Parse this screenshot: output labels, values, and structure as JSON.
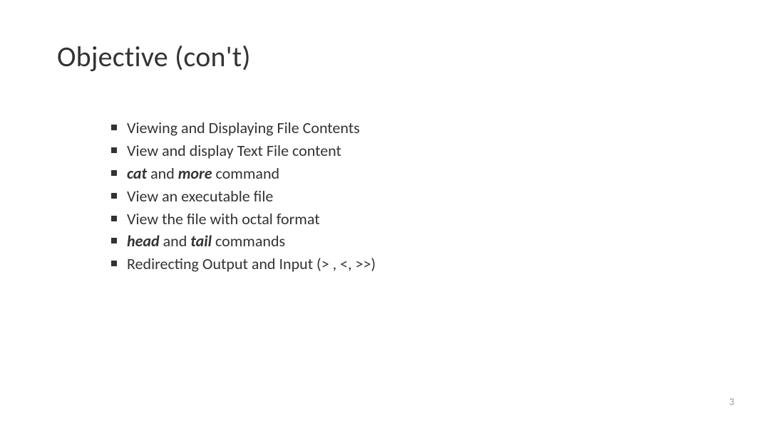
{
  "title": "Objective (con't)",
  "bullets": [
    {
      "parts": [
        {
          "text": "Viewing and Displaying File Contents",
          "style": "normal"
        }
      ]
    },
    {
      "parts": [
        {
          "text": "View and display Text File content",
          "style": "normal"
        }
      ]
    },
    {
      "parts": [
        {
          "text": "cat",
          "style": "bold-italic"
        },
        {
          "text": " and ",
          "style": "normal"
        },
        {
          "text": "more",
          "style": "bold-italic"
        },
        {
          "text": " command",
          "style": "normal"
        }
      ]
    },
    {
      "parts": [
        {
          "text": "View an executable file",
          "style": "normal"
        }
      ]
    },
    {
      "parts": [
        {
          "text": "View the file with octal format",
          "style": "normal"
        }
      ]
    },
    {
      "parts": [
        {
          "text": "head",
          "style": "bold-italic"
        },
        {
          "text": " and ",
          "style": "normal"
        },
        {
          "text": "tail",
          "style": "bold-italic"
        },
        {
          "text": " commands",
          "style": "normal"
        }
      ]
    },
    {
      "parts": [
        {
          "text": "Redirecting Output and Input (> , <, >>)",
          "style": "normal"
        }
      ]
    }
  ],
  "pageNumber": "3"
}
